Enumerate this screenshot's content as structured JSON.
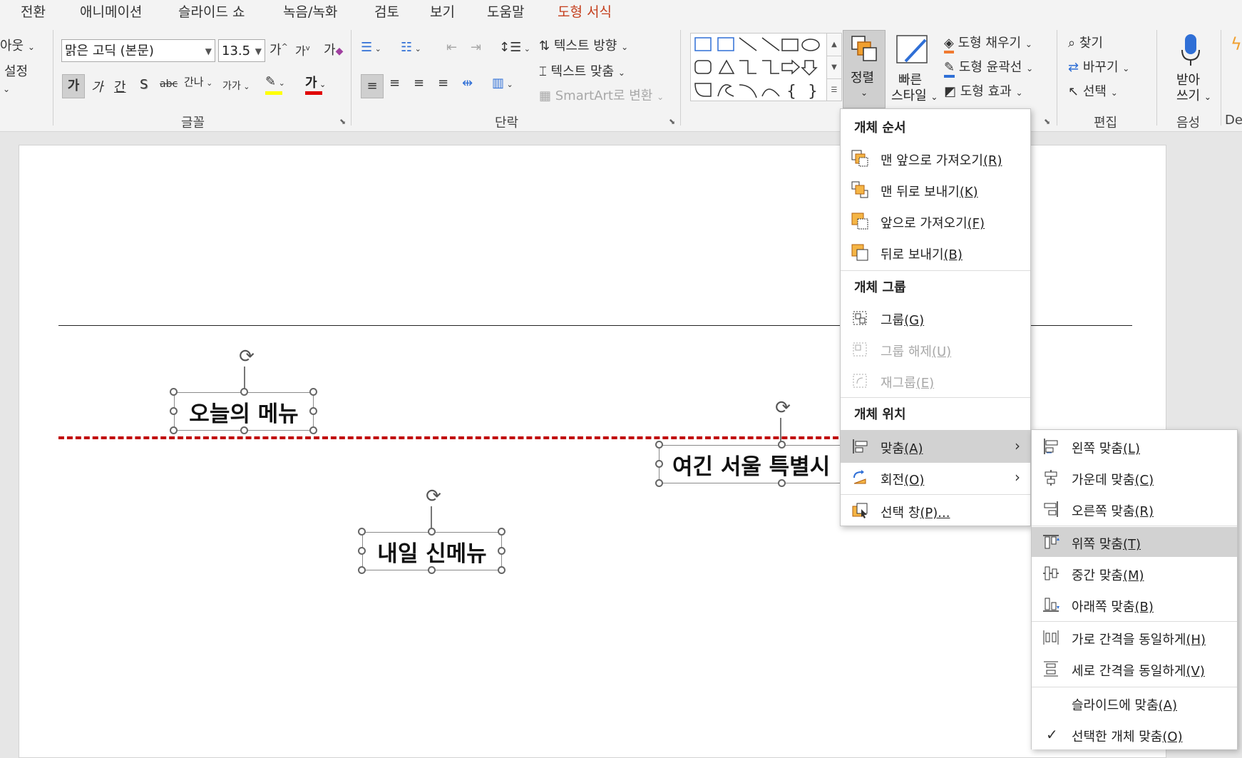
{
  "tabs": [
    {
      "label": "전환"
    },
    {
      "label": "애니메이션"
    },
    {
      "label": "슬라이드 쇼"
    },
    {
      "label": "녹음/녹화"
    },
    {
      "label": "검토"
    },
    {
      "label": "보기"
    },
    {
      "label": "도움말"
    },
    {
      "label": "도형 서식"
    }
  ],
  "ribbon": {
    "left_partial": {
      "layout": "아웃",
      "setup": "설정"
    },
    "font": {
      "name": "맑은 고딕 (본문)",
      "size": "13.5",
      "group_label": "글꼴",
      "bold": "가",
      "italic": "가",
      "underline": "간",
      "shadow": "S",
      "strike": "abc",
      "spacing": "간나",
      "case": "가가",
      "grow": "가",
      "shrink": "가",
      "clear": "가",
      "highlight": "가",
      "color": "가",
      "highlight_color": "#ffff00",
      "font_color": "#e00000"
    },
    "paragraph": {
      "group_label": "단락",
      "text_direction": "텍스트 방향",
      "align_text": "텍스트 맞춤",
      "smartart": "SmartArt로 변환"
    },
    "drawing": {
      "arrange": "정렬",
      "quick_styles_1": "빠른",
      "quick_styles_2": "스타일",
      "fill": "도형 채우기",
      "outline": "도형 윤곽선",
      "effects": "도형 효과",
      "fill_color": "#f07a30",
      "outline_color": "#2f6fd6"
    },
    "editing": {
      "group_label": "편집",
      "find": "찾기",
      "replace": "바꾸기",
      "select": "선택"
    },
    "voice": {
      "group_label": "음성",
      "dictate_1": "받아",
      "dictate_2": "쓰기"
    },
    "designer_partial": "De"
  },
  "slide": {
    "box_today": "오늘의 메뉴",
    "box_tomorrow": "내일 신메뉴",
    "box_seoul": "여긴 서울 특별시",
    "guide_color": "#c00000"
  },
  "arrange_menu": {
    "order_header": "개체 순서",
    "bring_front": "맨 앞으로 가져오기",
    "bring_front_key": "(R)",
    "send_back": "맨 뒤로 보내기",
    "send_back_key": "(K)",
    "bring_forward": "앞으로 가져오기",
    "bring_forward_key": "(F)",
    "send_backward": "뒤로 보내기",
    "send_backward_key": "(B)",
    "group_header": "개체 그룹",
    "group": "그룹",
    "group_key": "(G)",
    "ungroup": "그룹 해제",
    "ungroup_key": "(U)",
    "regroup": "재그룹",
    "regroup_key": "(E)",
    "position_header": "개체 위치",
    "align": "맞춤",
    "align_key": "(A)",
    "rotate": "회전",
    "rotate_key": "(O)",
    "selection_pane": "선택 창",
    "selection_pane_key": "(P)..."
  },
  "align_submenu": {
    "left": "왼쪽 맞춤",
    "left_key": "(L)",
    "center": "가운데 맞춤",
    "center_key": "(C)",
    "right": "오른쪽 맞춤",
    "right_key": "(R)",
    "top": "위쪽 맞춤",
    "top_key": "(T)",
    "middle": "중간 맞춤",
    "middle_key": "(M)",
    "bottom": "아래쪽 맞춤",
    "bottom_key": "(B)",
    "dist_h": "가로 간격을 동일하게",
    "dist_h_key": "(H)",
    "dist_v": "세로 간격을 동일하게",
    "dist_v_key": "(V)",
    "to_slide": "슬라이드에 맞춤",
    "to_slide_key": "(A)",
    "to_selected": "선택한 개체 맞춤",
    "to_selected_key": "(O)",
    "checked_mark": "✓"
  }
}
